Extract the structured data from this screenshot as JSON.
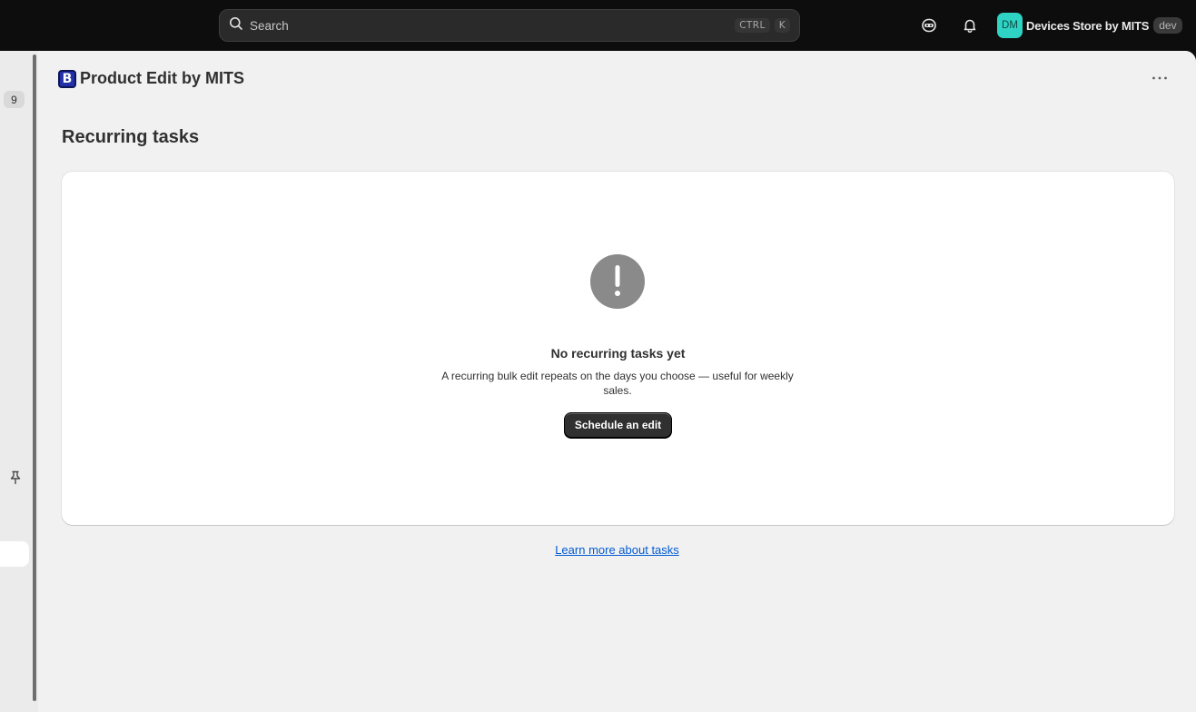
{
  "topbar": {
    "search": {
      "placeholder": "Search",
      "shortcut_mod": "CTRL",
      "shortcut_key": "K"
    },
    "store": {
      "initials": "DM",
      "name": "Devices Store by MITS",
      "badge": "dev"
    }
  },
  "sidebar": {
    "count_badge": "9"
  },
  "app": {
    "logo_letter": "B",
    "title": "Product Edit by MITS"
  },
  "page": {
    "title": "Recurring tasks"
  },
  "empty_state": {
    "heading": "No recurring tasks yet",
    "description": "A recurring bulk edit repeats on the days you choose — useful for weekly sales.",
    "cta_label": "Schedule an edit"
  },
  "footer_link": "Learn more about tasks",
  "colors": {
    "accent_avatar": "#2ed3c3",
    "primary_button": "#303030",
    "link": "#005bd3",
    "logo": "#2231a8"
  }
}
